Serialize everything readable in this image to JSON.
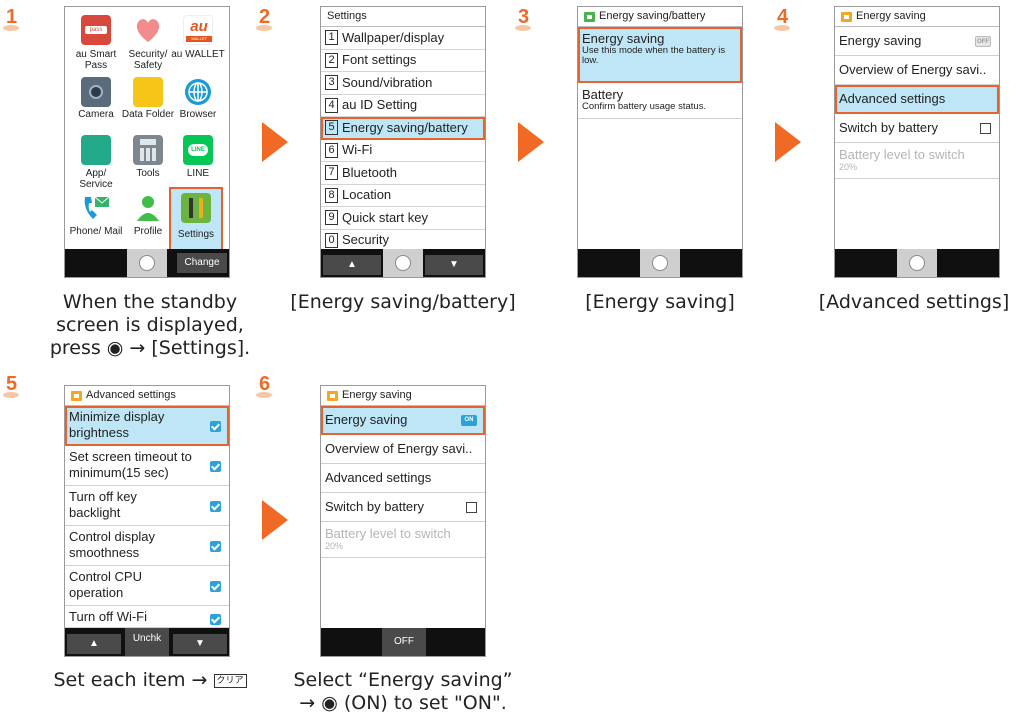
{
  "steps": [
    "1",
    "2",
    "3",
    "4",
    "5",
    "6"
  ],
  "colors": {
    "accent": "#f06a26",
    "highlight": "#bfe6f7",
    "check": "#2aa3dc"
  },
  "screen1": {
    "apps": [
      {
        "label": "au Smart Pass",
        "icon": "pass-icon"
      },
      {
        "label": "Security/ Safety",
        "icon": "heart-icon"
      },
      {
        "label": "au WALLET",
        "icon": "au-wallet-icon"
      },
      {
        "label": "Camera",
        "icon": "camera-icon"
      },
      {
        "label": "Data Folder",
        "icon": "folder-icon"
      },
      {
        "label": "Browser",
        "icon": "globe-icon"
      },
      {
        "label": "App/ Service",
        "icon": "apps-icon"
      },
      {
        "label": "Tools",
        "icon": "calculator-icon"
      },
      {
        "label": "LINE",
        "icon": "line-icon"
      },
      {
        "label": "Phone/ Mail",
        "icon": "phone-mail-icon"
      },
      {
        "label": "Profile",
        "icon": "profile-icon"
      },
      {
        "label": "Settings",
        "icon": "settings-icon"
      }
    ],
    "pass_badge": "pass",
    "au_logo": "au",
    "au_sub": "WALLET",
    "line_badge": "LINE",
    "right_softkey": "Change",
    "caption": [
      "When the standby",
      "screen is displayed,",
      "press ◉ → [Settings]."
    ]
  },
  "screen2": {
    "title": "Settings",
    "items": [
      {
        "num": "1",
        "label": "Wallpaper/display"
      },
      {
        "num": "2",
        "label": "Font settings"
      },
      {
        "num": "3",
        "label": "Sound/vibration"
      },
      {
        "num": "4",
        "label": "au ID Setting"
      },
      {
        "num": "5",
        "label": "Energy saving/battery"
      },
      {
        "num": "6",
        "label": "Wi-Fi"
      },
      {
        "num": "7",
        "label": "Bluetooth"
      },
      {
        "num": "8",
        "label": "Location"
      },
      {
        "num": "9",
        "label": "Quick start key"
      },
      {
        "num": "0",
        "label": "Security"
      }
    ],
    "left_softkey": "▲",
    "right_softkey": "▼",
    "caption": "[Energy saving/battery]"
  },
  "screen3": {
    "title": "Energy saving/battery",
    "items": [
      {
        "label": "Energy saving",
        "desc": "Use this mode when the battery is low."
      },
      {
        "label": "Battery",
        "desc": "Confirm battery usage status."
      }
    ],
    "caption": "[Energy saving]"
  },
  "screen4": {
    "title": "Energy saving",
    "items": [
      {
        "label": "Energy saving",
        "badge": "OFF"
      },
      {
        "label": "Overview of Energy savi.."
      },
      {
        "label": "Advanced settings"
      },
      {
        "label": "Switch by battery"
      },
      {
        "label": "Battery level to switch",
        "sub": "20%"
      }
    ],
    "caption": "[Advanced settings]"
  },
  "screen5": {
    "title": "Advanced settings",
    "items": [
      {
        "label": "Minimize display brightness"
      },
      {
        "label": "Set screen timeout to minimum(15 sec)"
      },
      {
        "label": "Turn off key backlight"
      },
      {
        "label": "Control display smoothness"
      },
      {
        "label": "Control CPU operation"
      },
      {
        "label": "Turn off Wi-Fi"
      }
    ],
    "left_softkey": "▲",
    "center_softkey": "Unchk",
    "right_softkey": "▼",
    "caption_text": "Set each item →",
    "caption_key": "クリア"
  },
  "screen6": {
    "title": "Energy saving",
    "items": [
      {
        "label": "Energy saving",
        "badge": "ON"
      },
      {
        "label": "Overview of Energy savi.."
      },
      {
        "label": "Advanced settings"
      },
      {
        "label": "Switch by battery"
      },
      {
        "label": "Battery level to switch",
        "sub": "20%"
      }
    ],
    "center_softkey": "OFF",
    "caption": [
      "Select “Energy saving”",
      "→ ◉ (ON) to set \"ON\"."
    ]
  }
}
